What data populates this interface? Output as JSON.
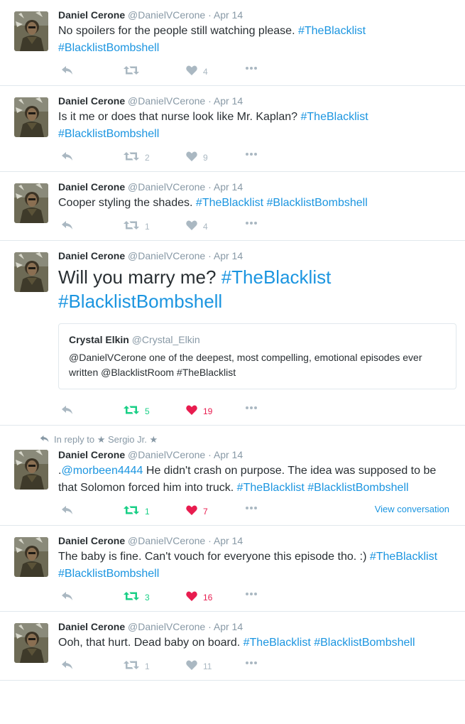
{
  "tweets": [
    {
      "name": "Daniel Cerone",
      "handle": "@DanielVCerone",
      "date": "· Apr 14",
      "segments": [
        {
          "text": "No spoilers for the people still watching please. ",
          "kind": "text"
        },
        {
          "text": "#TheBlacklist",
          "kind": "hashtag"
        },
        {
          "text": " ",
          "kind": "text"
        },
        {
          "text": "#BlacklistBombshell",
          "kind": "hashtag"
        }
      ],
      "retweets": "",
      "likes": "4"
    },
    {
      "name": "Daniel Cerone",
      "handle": "@DanielVCerone",
      "date": "· Apr 14",
      "segments": [
        {
          "text": "Is it me or does that nurse look like Mr. Kaplan? ",
          "kind": "text"
        },
        {
          "text": "#TheBlacklist",
          "kind": "hashtag"
        },
        {
          "text": " ",
          "kind": "text"
        },
        {
          "text": "#BlacklistBombshell",
          "kind": "hashtag"
        }
      ],
      "retweets": "2",
      "likes": "9"
    },
    {
      "name": "Daniel Cerone",
      "handle": "@DanielVCerone",
      "date": "· Apr 14",
      "segments": [
        {
          "text": "Cooper styling the shades. ",
          "kind": "text"
        },
        {
          "text": "#TheBlacklist",
          "kind": "hashtag"
        },
        {
          "text": " ",
          "kind": "text"
        },
        {
          "text": "#BlacklistBombshell",
          "kind": "hashtag"
        }
      ],
      "retweets": "1",
      "likes": "4"
    },
    {
      "name": "Daniel Cerone",
      "handle": "@DanielVCerone",
      "date": "· Apr 14",
      "segments": [
        {
          "text": "Will you marry me? ",
          "kind": "text"
        },
        {
          "text": "#TheBlacklist",
          "kind": "hashtag"
        },
        {
          "text": " ",
          "kind": "text"
        },
        {
          "text": "#BlacklistBombshell",
          "kind": "hashtag"
        }
      ],
      "quote": {
        "name": "Crystal Elkin",
        "handle": "@Crystal_Elkin",
        "text": "@DanielVCerone one of the deepest, most compelling, emotional episodes ever written @BlacklistRoom #TheBlacklist"
      },
      "retweets": "5",
      "likes": "19"
    },
    {
      "name": "Daniel Cerone",
      "handle": "@DanielVCerone",
      "date": "· Apr 14",
      "reply_context": "In reply to ★ Sergio Jr. ★",
      "segments": [
        {
          "text": ".",
          "kind": "text"
        },
        {
          "text": "@morbeen4444",
          "kind": "mention"
        },
        {
          "text": " He didn't crash on purpose. The idea was supposed to be that Solomon forced him into truck. ",
          "kind": "text"
        },
        {
          "text": "#TheBlacklist",
          "kind": "hashtag"
        },
        {
          "text": " ",
          "kind": "text"
        },
        {
          "text": "#BlacklistBombshell",
          "kind": "hashtag"
        }
      ],
      "retweets": "1",
      "likes": "7",
      "view_conversation": "View conversation"
    },
    {
      "name": "Daniel Cerone",
      "handle": "@DanielVCerone",
      "date": "· Apr 14",
      "segments": [
        {
          "text": "The baby is fine. Can't vouch for everyone this episode tho. :) ",
          "kind": "text"
        },
        {
          "text": "#TheBlacklist",
          "kind": "hashtag"
        },
        {
          "text": " ",
          "kind": "text"
        },
        {
          "text": "#BlacklistBombshell",
          "kind": "hashtag"
        }
      ],
      "retweets": "3",
      "likes": "16"
    },
    {
      "name": "Daniel Cerone",
      "handle": "@DanielVCerone",
      "date": "· Apr 14",
      "segments": [
        {
          "text": "Ooh, that hurt. Dead baby on board. ",
          "kind": "text"
        },
        {
          "text": "#TheBlacklist",
          "kind": "hashtag"
        },
        {
          "text": " ",
          "kind": "text"
        },
        {
          "text": "#BlacklistBombshell",
          "kind": "hashtag"
        }
      ],
      "retweets": "1",
      "likes": "11"
    }
  ],
  "tweet_states": [
    {
      "rt_active": false,
      "like_active": false,
      "big": false
    },
    {
      "rt_active": false,
      "like_active": false,
      "big": false
    },
    {
      "rt_active": false,
      "like_active": false,
      "big": false
    },
    {
      "rt_active": true,
      "like_active": true,
      "big": true
    },
    {
      "rt_active": true,
      "like_active": true,
      "big": false
    },
    {
      "rt_active": true,
      "like_active": true,
      "big": false
    },
    {
      "rt_active": false,
      "like_active": false,
      "big": false
    }
  ],
  "colors": {
    "link": "#1b95e0",
    "icon": "#aab8c2",
    "retweet_active": "#19cf86",
    "like_active": "#e81c4f",
    "border": "#e1e8ed"
  },
  "icons": {
    "reply": "reply-icon",
    "retweet": "retweet-icon",
    "like": "heart-icon",
    "more": "more-dots-icon"
  }
}
